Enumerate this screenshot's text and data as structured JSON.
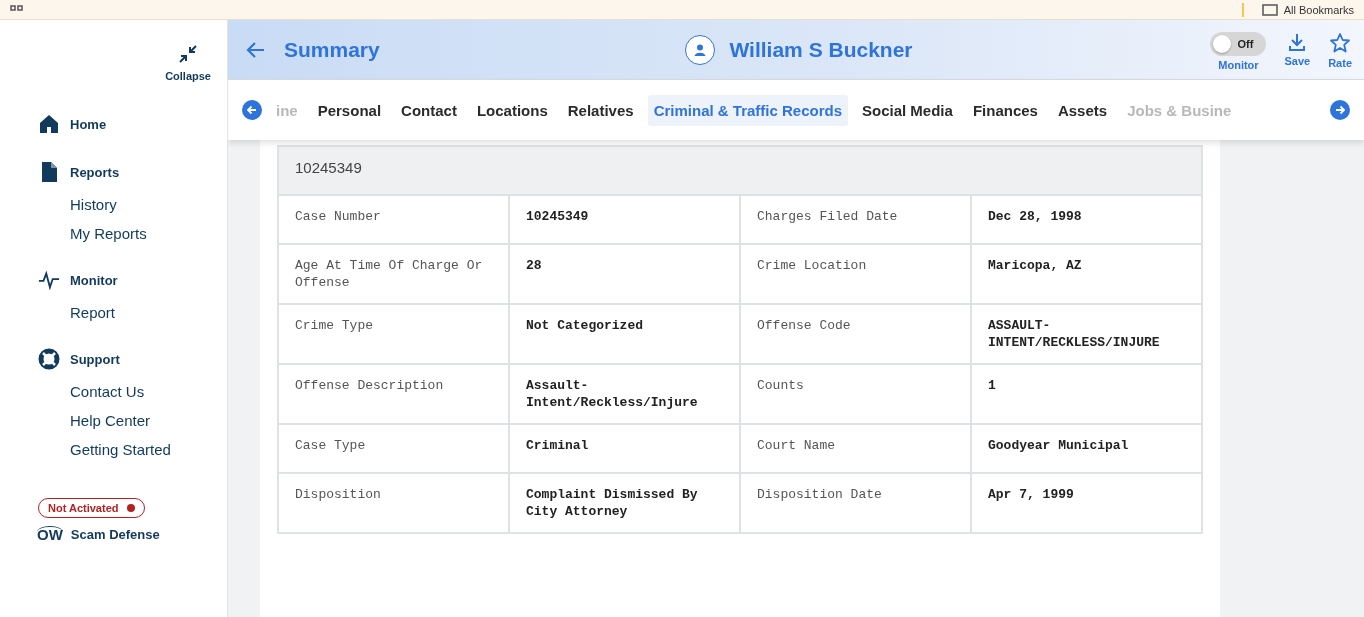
{
  "browser_bar": {
    "bookmarks_label": "All Bookmarks"
  },
  "sidebar": {
    "collapse_label": "Collapse",
    "sections": [
      {
        "label": "Home"
      },
      {
        "label": "Reports",
        "items": [
          "History",
          "My Reports"
        ]
      },
      {
        "label": "Monitor",
        "items": [
          "Report"
        ]
      },
      {
        "label": "Support",
        "items": [
          "Contact Us",
          "Help Center",
          "Getting Started"
        ]
      }
    ],
    "status_badge": {
      "label": "Not Activated",
      "color": "#b22222"
    },
    "scam_defense": {
      "logo": "OW",
      "label": "Scam Defense"
    }
  },
  "header": {
    "title": "Summary",
    "person_name": "William S Buckner",
    "monitor": {
      "state_label": "Off",
      "on": false,
      "label": "Monitor"
    },
    "actions": [
      {
        "label": "Save"
      },
      {
        "label": "Rate"
      }
    ]
  },
  "tabs": [
    {
      "label": "ine",
      "selected": false,
      "faded": true
    },
    {
      "label": "Personal",
      "selected": false,
      "faded": false
    },
    {
      "label": "Contact",
      "selected": false,
      "faded": false
    },
    {
      "label": "Locations",
      "selected": false,
      "faded": false
    },
    {
      "label": "Relatives",
      "selected": false,
      "faded": false
    },
    {
      "label": "Criminal & Traffic Records",
      "selected": true,
      "faded": false
    },
    {
      "label": "Social Media",
      "selected": false,
      "faded": false
    },
    {
      "label": "Finances",
      "selected": false,
      "faded": false
    },
    {
      "label": "Assets",
      "selected": false,
      "faded": false
    },
    {
      "label": "Jobs & Busine",
      "selected": false,
      "faded": true
    }
  ],
  "record": {
    "heading": "10245349",
    "rows": [
      [
        "Case Number",
        "10245349",
        "Charges Filed Date",
        "Dec 28, 1998"
      ],
      [
        "Age At Time Of Charge Or Offense",
        "28",
        "Crime Location",
        "Maricopa, AZ"
      ],
      [
        "Crime Type",
        "Not Categorized",
        "Offense Code",
        "ASSAULT-INTENT/RECKLESS/INJURE"
      ],
      [
        "Offense Description",
        "Assault-Intent/Reckless/Injure",
        "Counts",
        "1"
      ],
      [
        "Case Type",
        "Criminal",
        "Court Name",
        "Goodyear Municipal"
      ],
      [
        "Disposition",
        "Complaint Dismissed By City Attorney",
        "Disposition Date",
        "Apr 7, 1999"
      ]
    ]
  }
}
